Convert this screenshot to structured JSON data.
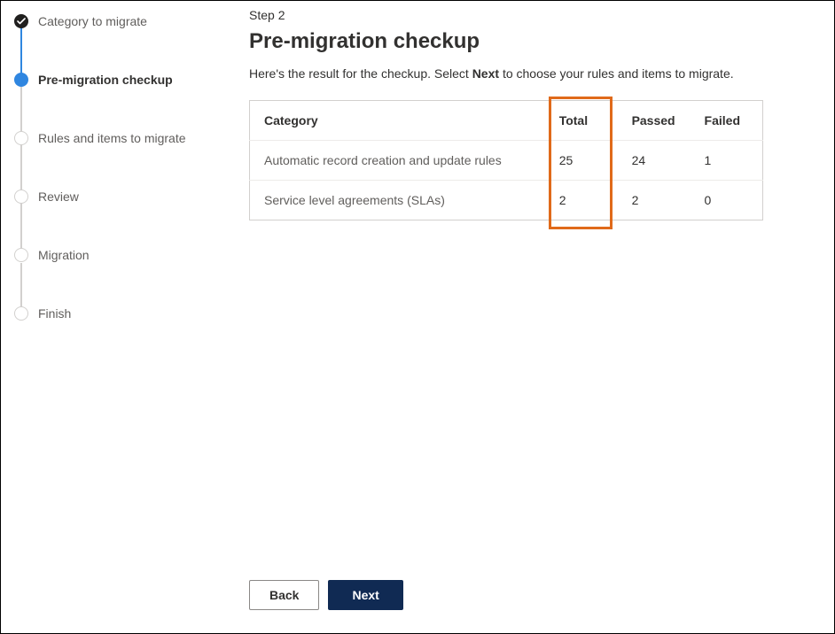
{
  "sidebar": {
    "steps": [
      {
        "label": "Category to migrate",
        "state": "done"
      },
      {
        "label": "Pre-migration checkup",
        "state": "current"
      },
      {
        "label": "Rules and items to migrate",
        "state": "future"
      },
      {
        "label": "Review",
        "state": "future"
      },
      {
        "label": "Migration",
        "state": "future"
      },
      {
        "label": "Finish",
        "state": "future"
      }
    ]
  },
  "main": {
    "step_label": "Step 2",
    "title": "Pre-migration checkup",
    "intro_pre": "Here's the result for the checkup. Select ",
    "intro_bold": "Next",
    "intro_post": " to choose your rules and items to migrate.",
    "table": {
      "headers": {
        "category": "Category",
        "total": "Total",
        "passed": "Passed",
        "failed": "Failed"
      },
      "rows": [
        {
          "category": "Automatic record creation and update rules",
          "total": "25",
          "passed": "24",
          "failed": "1"
        },
        {
          "category": "Service level agreements (SLAs)",
          "total": "2",
          "passed": "2",
          "failed": "0"
        }
      ]
    }
  },
  "footer": {
    "back": "Back",
    "next": "Next"
  }
}
